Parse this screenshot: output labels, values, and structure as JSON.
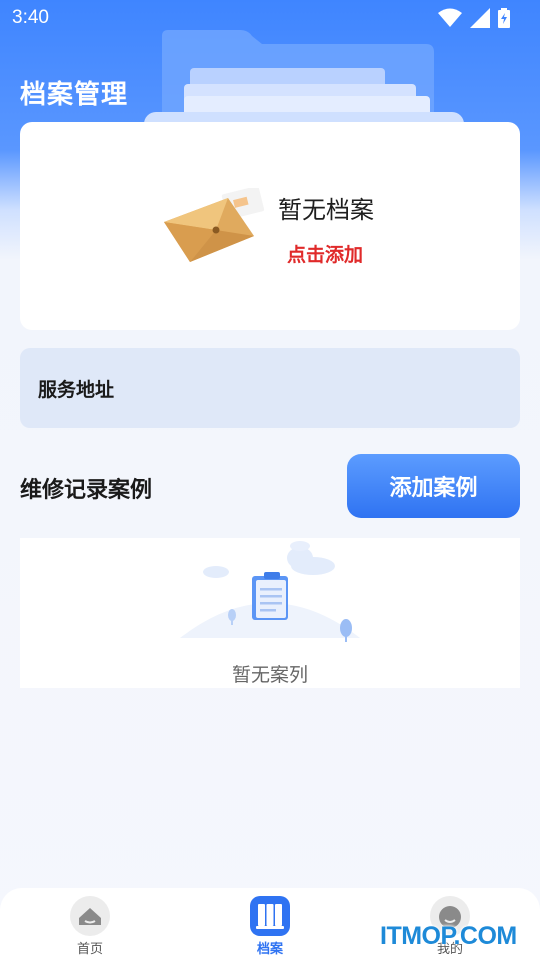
{
  "status_bar": {
    "time": "3:40",
    "icons": [
      "wifi-icon",
      "signal-icon",
      "battery-icon"
    ]
  },
  "header": {
    "title": "档案管理"
  },
  "archive_card": {
    "empty_text": "暂无档案",
    "add_link": "点击添加"
  },
  "service_address": {
    "label": "服务地址"
  },
  "repair_section": {
    "title": "维修记录案例",
    "add_button": "添加案例",
    "empty_text": "暂无案列"
  },
  "bottom_nav": {
    "items": [
      {
        "label": "首页",
        "icon": "home-icon",
        "active": false
      },
      {
        "label": "档案",
        "icon": "archive-icon",
        "active": true
      },
      {
        "label": "我的",
        "icon": "profile-icon",
        "active": false
      }
    ]
  },
  "watermark": "ITMOP.COM",
  "colors": {
    "primary": "#2f73f2",
    "header_blue": "#3f85ff",
    "accent_red": "#e02a2a",
    "service_bg": "#dfe8f8"
  }
}
